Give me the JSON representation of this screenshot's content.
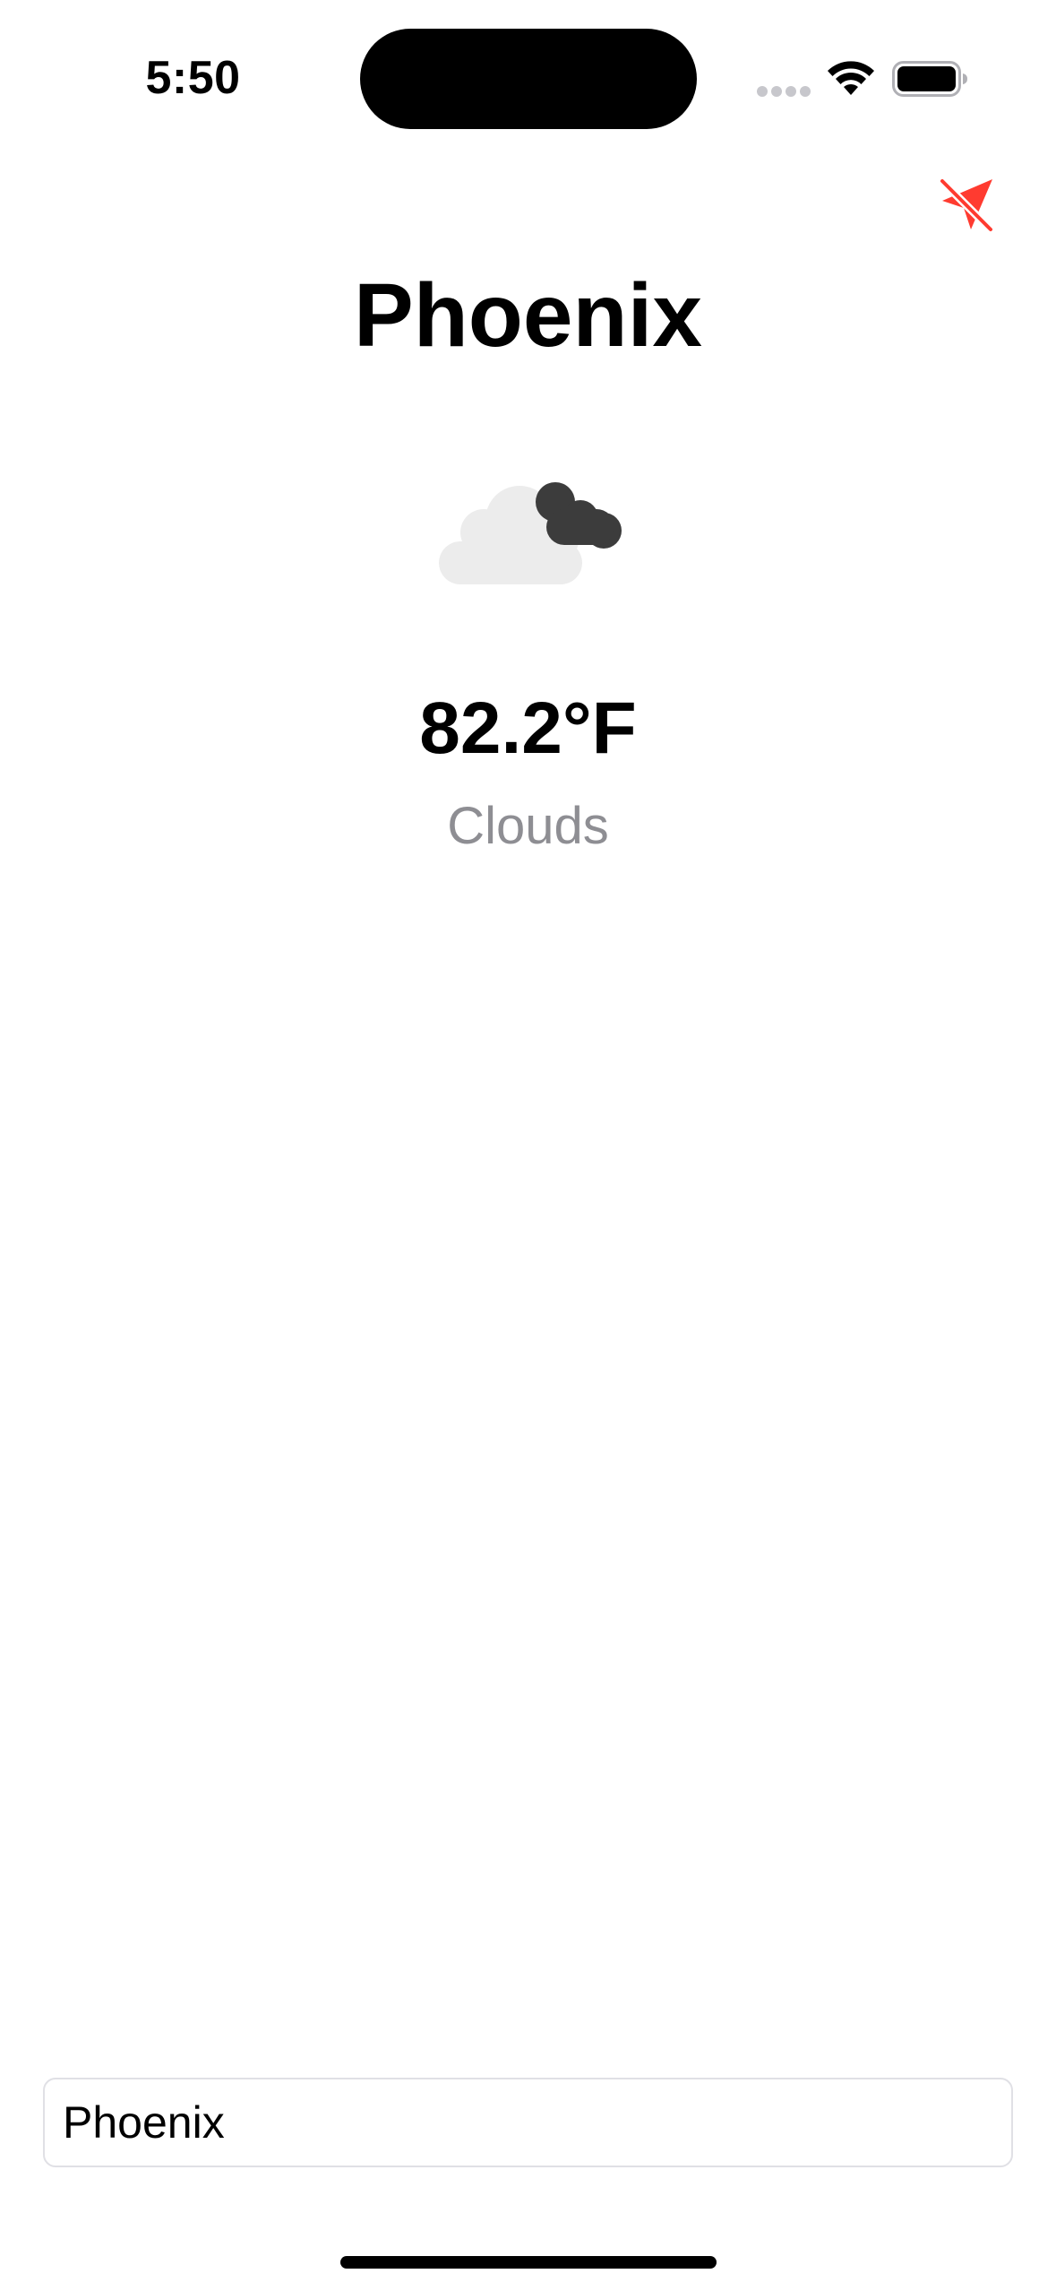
{
  "status_bar": {
    "time": "5:50",
    "icons": [
      "signal-dots-icon",
      "wifi-icon",
      "battery-icon"
    ]
  },
  "location_button": {
    "icon": "location-slash-icon",
    "color": "#ff3b30"
  },
  "weather": {
    "city": "Phoenix",
    "icon": "clouds-icon",
    "temperature": "82.2°F",
    "condition": "Clouds"
  },
  "search": {
    "value": "Phoenix"
  }
}
